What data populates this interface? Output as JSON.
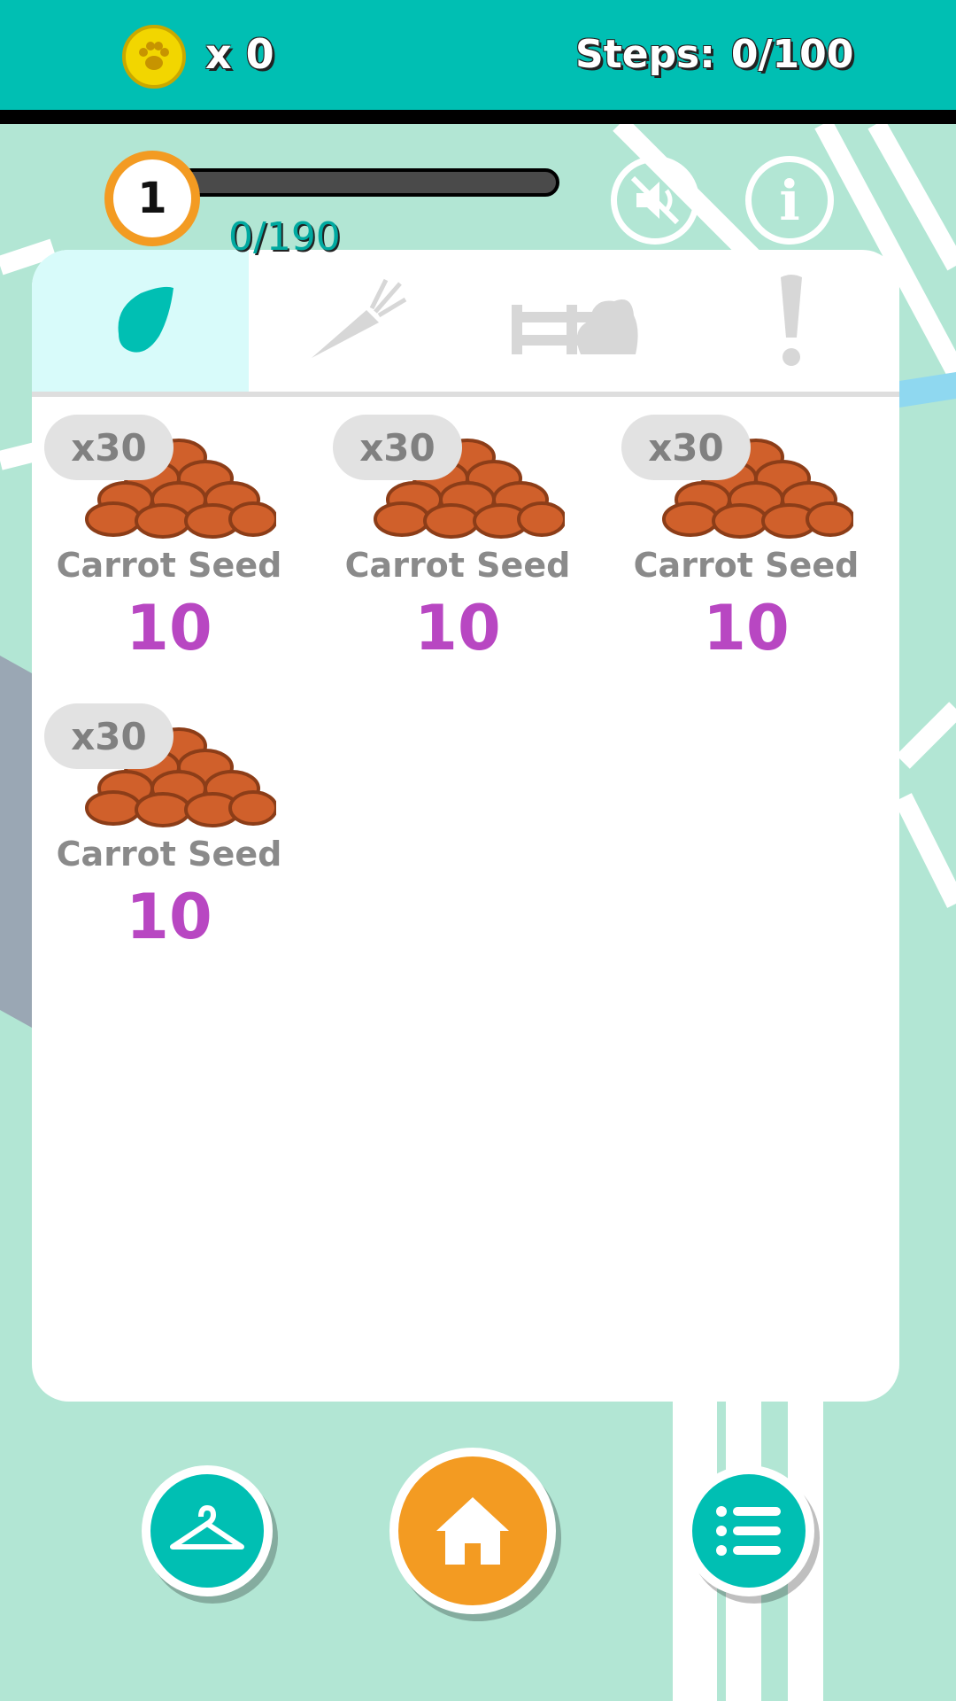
{
  "header": {
    "coin_icon": "paw-coin-icon",
    "coin_count": "x 0",
    "steps_label": "Steps:",
    "steps_value": "0/100"
  },
  "level": {
    "number": "1",
    "xp_text": "0/190",
    "xp_progress": 0
  },
  "controls": {
    "sound_icon": "sound-muted-icon",
    "info_icon": "info-icon",
    "info_glyph": "i"
  },
  "tabs": [
    {
      "icon": "seed-drop-icon",
      "active": true
    },
    {
      "icon": "carrot-icon",
      "active": false
    },
    {
      "icon": "fence-bush-icon",
      "active": false
    },
    {
      "icon": "exclamation-icon",
      "active": false
    }
  ],
  "items": [
    {
      "qty": "x30",
      "name": "Carrot Seed",
      "price": "10"
    },
    {
      "qty": "x30",
      "name": "Carrot Seed",
      "price": "10"
    },
    {
      "qty": "x30",
      "name": "Carrot Seed",
      "price": "10"
    },
    {
      "qty": "x30",
      "name": "Carrot Seed",
      "price": "10"
    }
  ],
  "nav": {
    "wardrobe_icon": "hanger-icon",
    "home_icon": "home-icon",
    "list_icon": "list-icon"
  },
  "colors": {
    "teal": "#00bfb3",
    "orange": "#f39b22",
    "price_purple": "#b847c2",
    "map_green": "#b2e6d4"
  }
}
